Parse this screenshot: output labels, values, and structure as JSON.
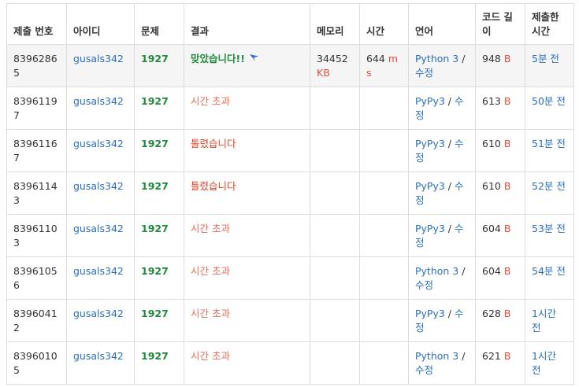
{
  "headers": [
    "제출 번호",
    "아이디",
    "문제",
    "결과",
    "메모리",
    "시간",
    "언어",
    "코드 길이",
    "제출한 시간"
  ],
  "rows": [
    {
      "id": "83962865",
      "user": "gusals342",
      "problem": "1927",
      "result": "맞았습니다!!",
      "result_type": "ac",
      "memory": "34452",
      "memory_unit": "KB",
      "time": "644",
      "time_unit": "ms",
      "lang": "Python 3",
      "edit": "수정",
      "length": "948",
      "length_unit": "B",
      "submitted": "5분 전",
      "highlight": true
    },
    {
      "id": "83961197",
      "user": "gusals342",
      "problem": "1927",
      "result": "시간 초과",
      "result_type": "tle",
      "memory": "",
      "memory_unit": "",
      "time": "",
      "time_unit": "",
      "lang": "PyPy3",
      "edit": "수정",
      "length": "613",
      "length_unit": "B",
      "submitted": "50분 전",
      "highlight": false
    },
    {
      "id": "83961167",
      "user": "gusals342",
      "problem": "1927",
      "result": "틀렸습니다",
      "result_type": "wa",
      "memory": "",
      "memory_unit": "",
      "time": "",
      "time_unit": "",
      "lang": "PyPy3",
      "edit": "수정",
      "length": "610",
      "length_unit": "B",
      "submitted": "51분 전",
      "highlight": false
    },
    {
      "id": "83961143",
      "user": "gusals342",
      "problem": "1927",
      "result": "틀렸습니다",
      "result_type": "wa",
      "memory": "",
      "memory_unit": "",
      "time": "",
      "time_unit": "",
      "lang": "PyPy3",
      "edit": "수정",
      "length": "610",
      "length_unit": "B",
      "submitted": "52분 전",
      "highlight": false
    },
    {
      "id": "83961103",
      "user": "gusals342",
      "problem": "1927",
      "result": "시간 초과",
      "result_type": "tle",
      "memory": "",
      "memory_unit": "",
      "time": "",
      "time_unit": "",
      "lang": "PyPy3",
      "edit": "수정",
      "length": "604",
      "length_unit": "B",
      "submitted": "53분 전",
      "highlight": false
    },
    {
      "id": "83961056",
      "user": "gusals342",
      "problem": "1927",
      "result": "시간 초과",
      "result_type": "tle",
      "memory": "",
      "memory_unit": "",
      "time": "",
      "time_unit": "",
      "lang": "Python 3",
      "edit": "수정",
      "length": "604",
      "length_unit": "B",
      "submitted": "54분 전",
      "highlight": false
    },
    {
      "id": "83960412",
      "user": "gusals342",
      "problem": "1927",
      "result": "시간 초과",
      "result_type": "tle",
      "memory": "",
      "memory_unit": "",
      "time": "",
      "time_unit": "",
      "lang": "PyPy3",
      "edit": "수정",
      "length": "628",
      "length_unit": "B",
      "submitted": "1시간 전",
      "highlight": false
    },
    {
      "id": "83960105",
      "user": "gusals342",
      "problem": "1927",
      "result": "시간 초과",
      "result_type": "tle",
      "memory": "",
      "memory_unit": "",
      "time": "",
      "time_unit": "",
      "lang": "Python 3",
      "edit": "수정",
      "length": "621",
      "length_unit": "B",
      "submitted": "1시간 전",
      "highlight": false
    }
  ],
  "icons": {
    "ac_flag": "flag-icon"
  },
  "colors": {
    "accepted": "#1f8a3c",
    "wrong": "#dd4124",
    "timeout": "#e66a58",
    "link": "#2a6ebb",
    "unit": "#e74c3c",
    "highlight_row": "#f5f5f5"
  }
}
